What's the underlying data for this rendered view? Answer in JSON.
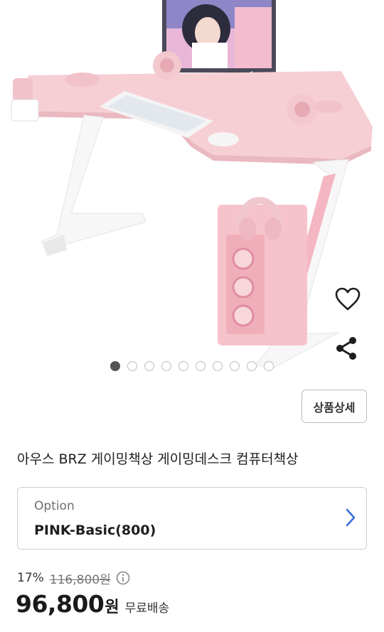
{
  "product": {
    "image_alt": "Pink gaming desk",
    "title": "아우스 BRZ 게이밍책상 게이밍데스크 컴퓨터책상",
    "detail_button": "상품상세",
    "gallery": {
      "total": 10,
      "active_index": 0
    }
  },
  "option": {
    "label": "Option",
    "value": "PINK-Basic(800)"
  },
  "price": {
    "discount": "17%",
    "original": "116,800원",
    "final_value": "96,800",
    "final_unit": "원",
    "shipping": "무료배송"
  },
  "icons": {
    "favorite": "heart-outline-icon",
    "share": "share-icon",
    "info": "info-circle-icon",
    "chevron": "chevron-right-icon"
  },
  "colors": {
    "accent": "#3a6fd8",
    "desk_pink": "#f6cfd4"
  }
}
